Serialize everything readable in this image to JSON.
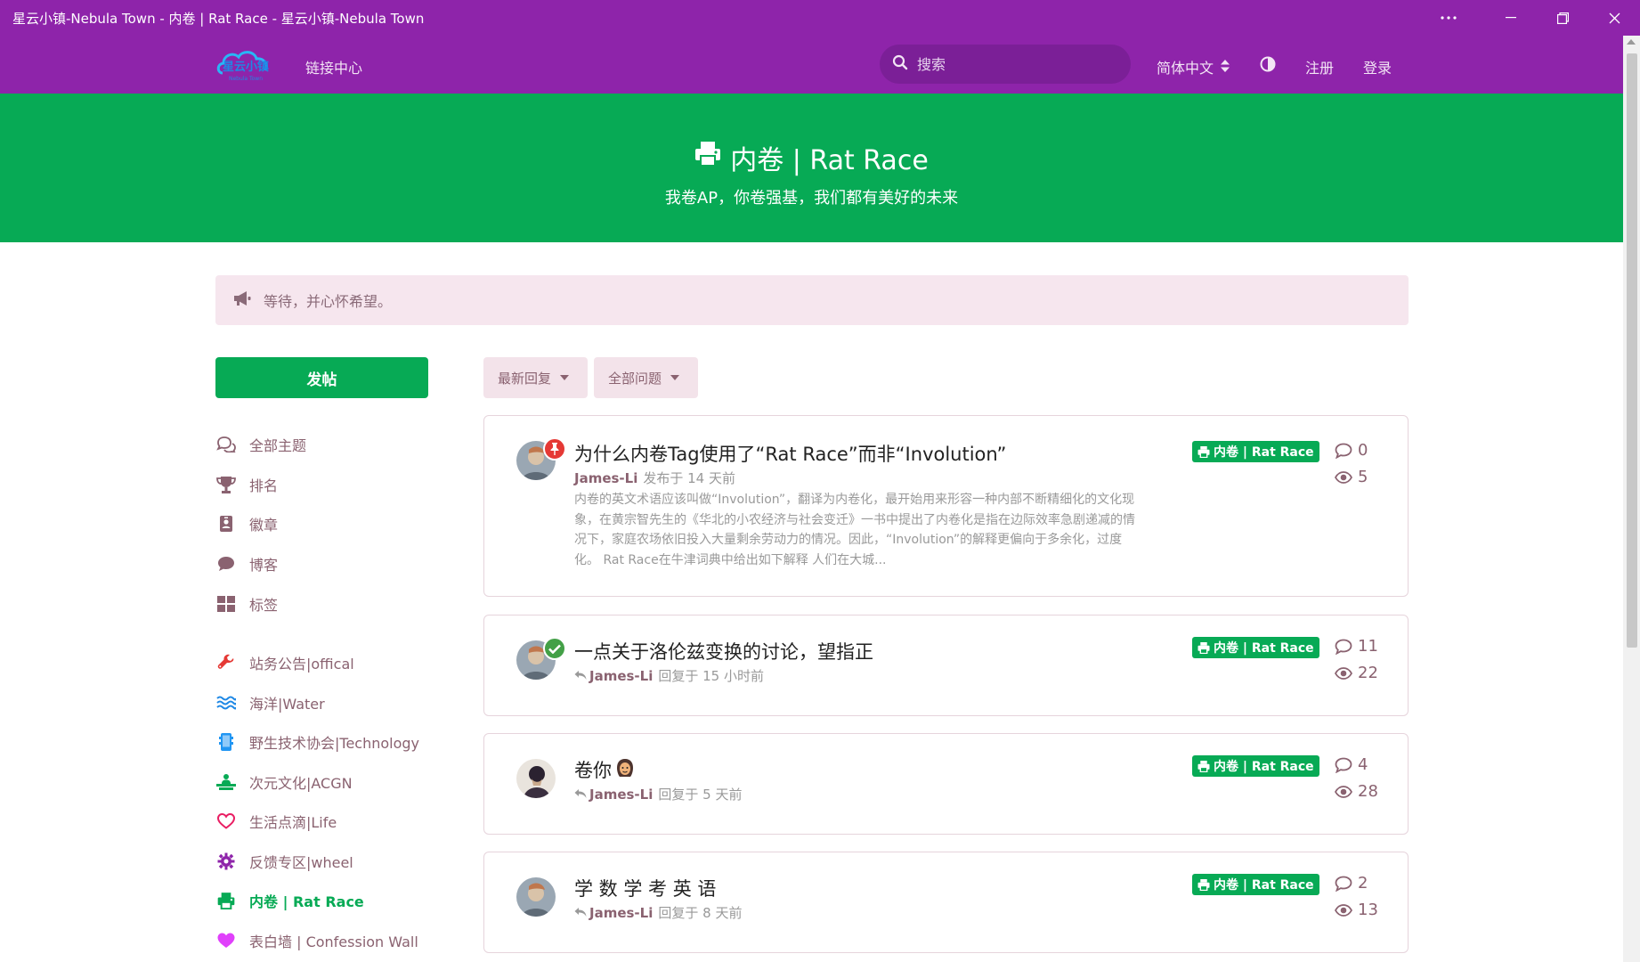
{
  "window": {
    "title": "星云小镇-Nebula Town - 内卷 | Rat Race - 星云小镇-Nebula Town",
    "controls": [
      "more-icon",
      "minimize-icon",
      "restore-icon",
      "close-icon"
    ]
  },
  "header": {
    "logo_text": "星云小镇",
    "logo_subtext": "Nebula Town",
    "link_center": "链接中心",
    "search_placeholder": "搜索",
    "language": "简体中文",
    "register": "注册",
    "login": "登录"
  },
  "hero": {
    "title": "内卷 | Rat Race",
    "subtitle": "我卷AP，你卷强基，我们都有美好的未来"
  },
  "notice": {
    "text": "等待，并心怀希望。"
  },
  "sidebar": {
    "post_button": "发帖",
    "nav": [
      {
        "label": "全部主题",
        "icon": "comments-icon"
      },
      {
        "label": "排名",
        "icon": "trophy-icon"
      },
      {
        "label": "徽章",
        "icon": "badge-icon"
      },
      {
        "label": "博客",
        "icon": "comment-icon"
      },
      {
        "label": "标签",
        "icon": "tags-grid-icon"
      }
    ],
    "tags": [
      {
        "label": "站务公告|offical",
        "icon": "wrench-icon",
        "color": "#e53935"
      },
      {
        "label": "海洋|Water",
        "icon": "water-icon",
        "color": "#1e88e5"
      },
      {
        "label": "野生技术协会|Technology",
        "icon": "mobile-icon",
        "color": "#2196f3"
      },
      {
        "label": "次元文化|ACGN",
        "icon": "gamer-icon",
        "color": "#07aa55"
      },
      {
        "label": "生活点滴|Life",
        "icon": "heart-outline-icon",
        "color": "#e91e63"
      },
      {
        "label": "反馈专区|wheel",
        "icon": "gear-icon",
        "color": "#8e24aa"
      },
      {
        "label": "内卷 | Rat Race",
        "icon": "printer-icon",
        "color": "#07aa55",
        "active": true
      },
      {
        "label": "表白墙 | Confession Wall",
        "icon": "heart-solid-icon",
        "color": "#e040fb"
      }
    ]
  },
  "filters": {
    "sort": "最新回复",
    "scope": "全部问题"
  },
  "discussions": [
    {
      "title": "为什么内卷Tag使用了“Rat Race”而非“Involution”",
      "author": "James-Li",
      "meta": "发布于 14 天前",
      "excerpt": "内卷的英文术语应该叫做“Involution”，翻译为内卷化，最开始用来形容一种内部不断精细化的文化现象，在黄宗智先生的《华北的小农经济与社会变迁》一书中提出了内卷化是指在边际效率急剧递减的情况下，家庭农场依旧投入大量剩余劳动力的情况。因此，“Involution”的解释更偏向于多余化，过度化。 Rat Race在牛津词典中给出如下解释 人们在大城...",
      "tag": "内卷 | Rat Race",
      "replies": "0",
      "views": "5",
      "badge": "pin"
    },
    {
      "title": "一点关于洛伦兹变换的讨论，望指正",
      "author": "James-Li",
      "meta": "回复于 15 小时前",
      "tag": "内卷 | Rat Race",
      "replies": "11",
      "views": "22",
      "badge": "check"
    },
    {
      "title": "卷你",
      "author": "James-Li",
      "meta": "回复于 5 天前",
      "tag": "内卷 | Rat Race",
      "replies": "4",
      "views": "28"
    },
    {
      "title": "学 数 学 考 英 语",
      "author": "James-Li",
      "meta": "回复于 8 天前",
      "tag": "内卷 | Rat Race",
      "replies": "2",
      "views": "13"
    }
  ]
}
